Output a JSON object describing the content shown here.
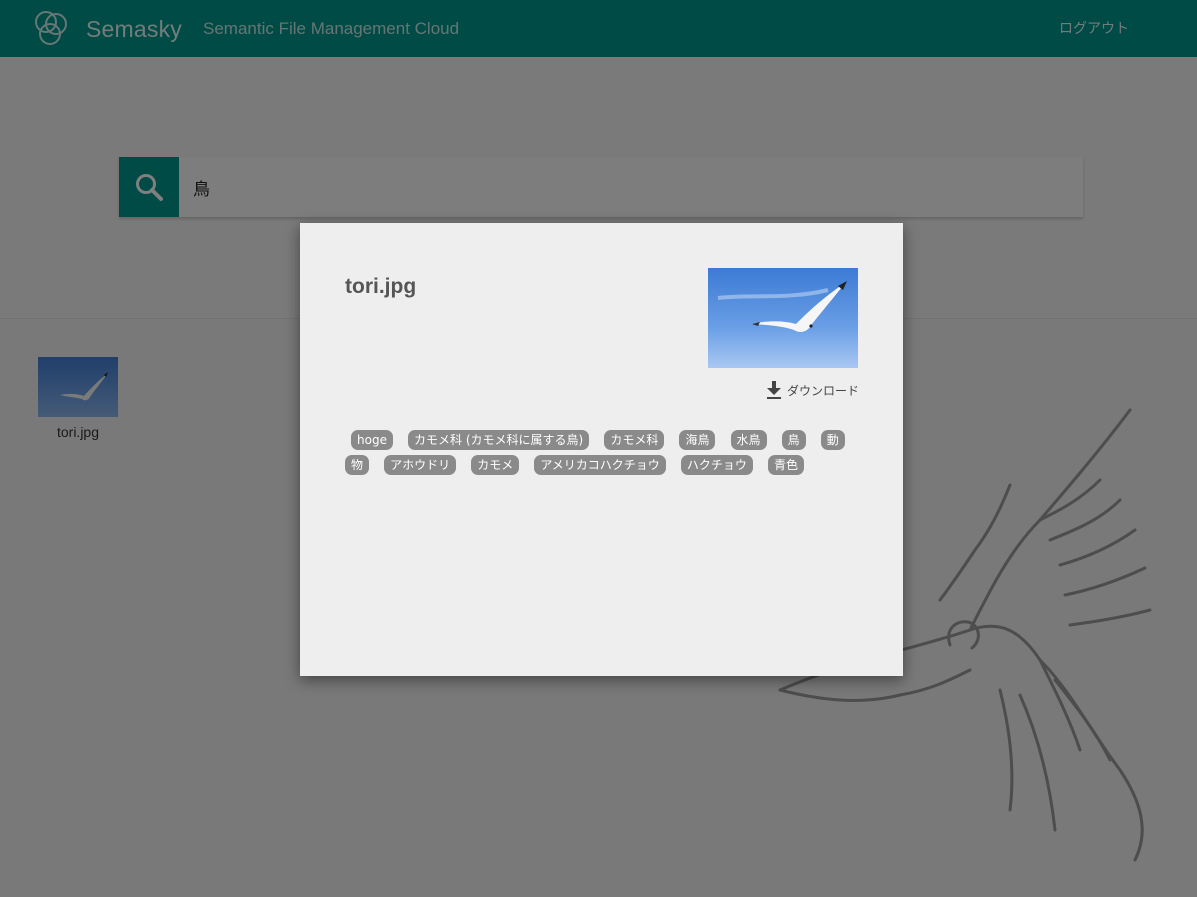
{
  "header": {
    "brand": "Semasky",
    "tagline": "Semantic File Management Cloud",
    "logout_label": "ログアウト"
  },
  "search": {
    "query": "鳥"
  },
  "results": [
    {
      "filename": "tori.jpg"
    }
  ],
  "modal": {
    "title": "tori.jpg",
    "download_label": "ダウンロード",
    "tags": [
      "hoge",
      "カモメ科 (カモメ科に属する鳥)",
      "カモメ科",
      "海鳥",
      "水鳥",
      "鳥",
      "動物",
      "アホウドリ",
      "カモメ",
      "アメリカコハクチョウ",
      "ハクチョウ",
      "青色"
    ]
  },
  "colors": {
    "brand_teal": "#01968a",
    "tag_gray": "#8a8a8a",
    "sky_blue": "#4f8fe0"
  },
  "icons": [
    "logo-icon",
    "search-icon",
    "download-icon"
  ]
}
